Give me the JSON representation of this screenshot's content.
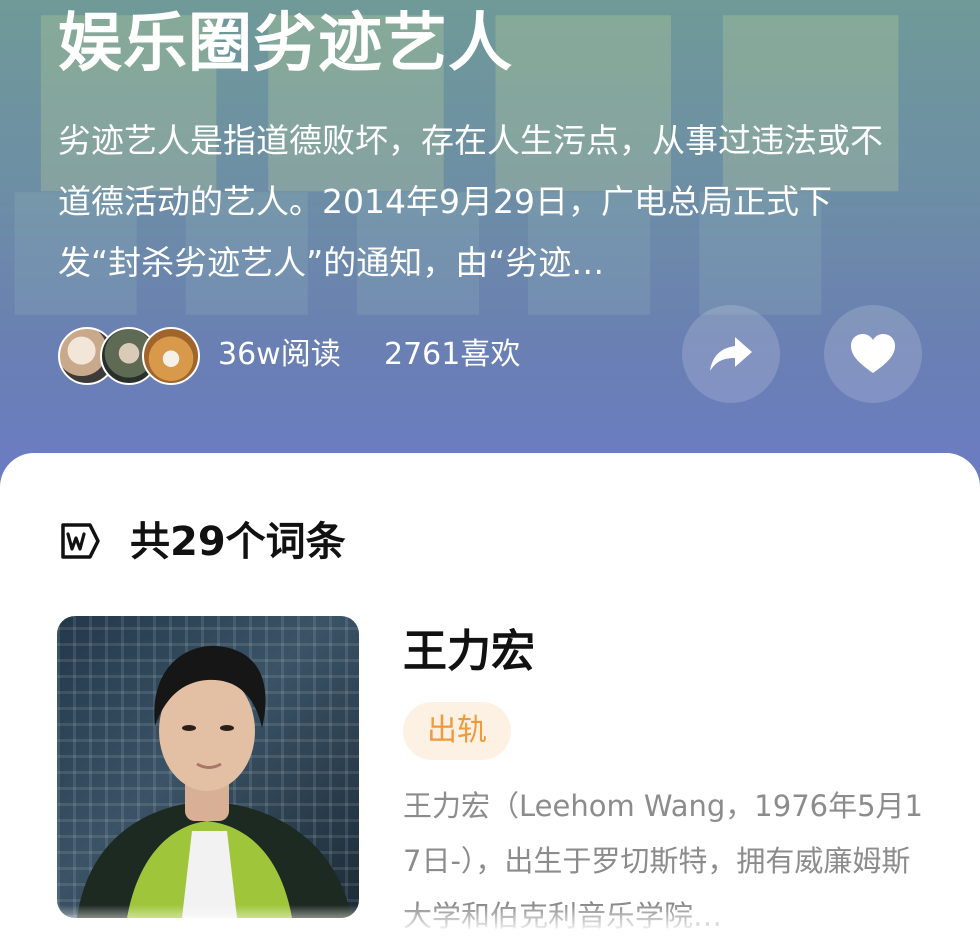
{
  "hero": {
    "title": "娱乐圈劣迹艺人",
    "description": "劣迹艺人是指道德败坏，存在人生污点，从事过违法或不道德活动的艺人。2014年9月29日，广电总局正式下发“封杀劣迹艺人”的通知，由“劣迹…",
    "stats": {
      "views": "36w阅读",
      "likes": "2761喜欢"
    },
    "reader_avatars": [
      "avatar-1",
      "avatar-2",
      "avatar-3"
    ],
    "actions": {
      "share_icon": "share-arrow-icon",
      "like_icon": "heart-icon"
    }
  },
  "section": {
    "icon": "wiki-icon",
    "title": "共29个词条"
  },
  "entries": [
    {
      "name": "王力宏",
      "tag": "出轨",
      "description": "王力宏（Leehom Wang，1976年5月17日-），出生于罗切斯特，拥有威廉姆斯大学和伯克利音乐学院…"
    }
  ],
  "colors": {
    "hero_top": "#6f9a98",
    "hero_bottom": "#6b7cc6",
    "tag_bg": "#fdf1e4",
    "tag_text": "#ef9a3c",
    "desc_text": "#8c8c8c"
  }
}
